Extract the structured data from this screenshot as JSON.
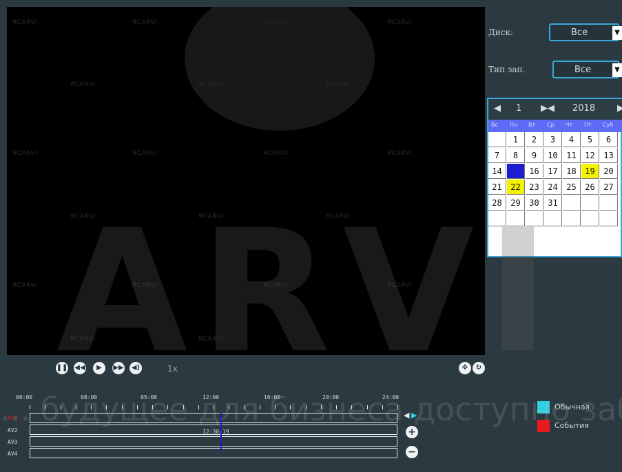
{
  "watermark": {
    "brand": "ARVI",
    "small": "ЯCARVI",
    "tagline": "...  будущее для бизнеса доступно заблаговременно"
  },
  "filters": {
    "disk_label": "Диск:",
    "disk_value": "Все",
    "rec_type_label": "Тип зап.",
    "rec_type_value": "Все"
  },
  "calendar": {
    "month": "1",
    "year": "2018",
    "weekdays": [
      "Вс",
      "Пн",
      "Вт",
      "Ср",
      "Чт",
      "Пт",
      "Суб"
    ],
    "rows": [
      [
        "",
        "1",
        "2",
        "3",
        "4",
        "5",
        "6"
      ],
      [
        "7",
        "8",
        "9",
        "10",
        "11",
        "12",
        "13"
      ],
      [
        "14",
        "15",
        "16",
        "17",
        "18",
        "19",
        "20"
      ],
      [
        "21",
        "22",
        "23",
        "24",
        "25",
        "26",
        "27"
      ],
      [
        "28",
        "29",
        "30",
        "31",
        "",
        "",
        ""
      ],
      [
        "",
        "",
        "",
        "",
        "",
        "",
        ""
      ]
    ],
    "selected_day": "15",
    "recorded_days": [
      "19",
      "22"
    ],
    "colors": {
      "selected": "#1d1dcf",
      "recorded": "#f3f300",
      "header": "#5e6bf6",
      "border": "#3aa8d8"
    }
  },
  "playback": {
    "speed": "1x",
    "buttons": [
      "pause-icon",
      "step-back-icon",
      "play-icon",
      "fast-forward-icon",
      "volume-icon"
    ]
  },
  "timeline": {
    "hours": [
      "00:00",
      "08:00",
      "05:00",
      "12:00",
      "16:00",
      "20:00",
      "24:00"
    ],
    "channels": [
      "AV1",
      "AV2",
      "AV3",
      "AV4"
    ],
    "current_time": "12:30:19"
  },
  "legend": {
    "normal": "Обычная",
    "event": "События",
    "normal_color": "#2fd0e0",
    "event_color": "#e81c1c"
  }
}
